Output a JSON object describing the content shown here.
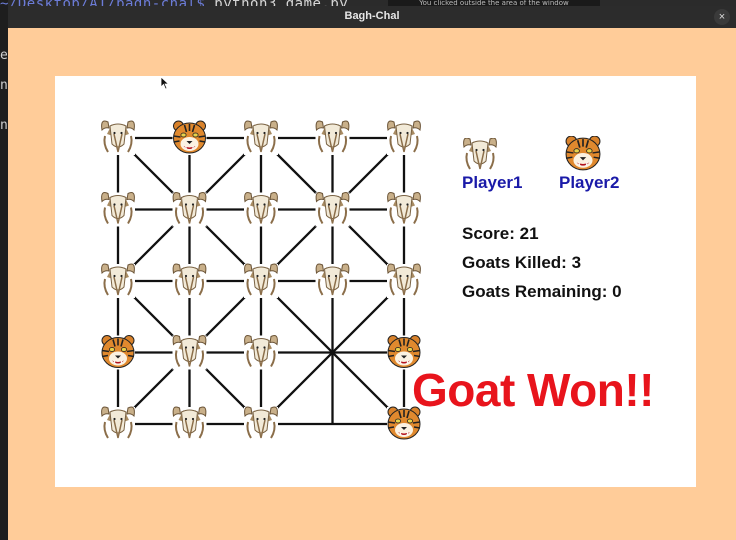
{
  "background_terminal": {
    "text_a": "~/Desktop/AI/bagh-chal$",
    "text_b": " python3 game.py"
  },
  "notification": {
    "text": "You clicked outside the area of the window"
  },
  "window": {
    "title": "Bagh-Chal",
    "close_glyph": "×"
  },
  "game": {
    "board": {
      "rows": [
        [
          "goat",
          "tiger",
          "goat",
          "goat",
          "goat"
        ],
        [
          "goat",
          "goat",
          "goat",
          "goat",
          "goat"
        ],
        [
          "goat",
          "goat",
          "goat",
          "goat",
          "goat"
        ],
        [
          "tiger",
          "goat",
          "goat",
          "empty",
          "tiger"
        ],
        [
          "goat",
          "goat",
          "goat",
          "empty",
          "tiger"
        ]
      ]
    },
    "players": [
      {
        "label": "Player1",
        "icon": "goat-icon"
      },
      {
        "label": "Player2",
        "icon": "tiger-icon"
      }
    ],
    "score_label": "Score: 21",
    "goats_killed_label": "Goats Killed: 3",
    "goats_remaining_label": "Goats Remaining: 0",
    "result_text": "Goat Won!!"
  },
  "colors": {
    "window_bg": "#ffcc99",
    "board_bg": "#ffffff",
    "player_text": "#1a1aa8",
    "result_text": "#e8141c"
  }
}
